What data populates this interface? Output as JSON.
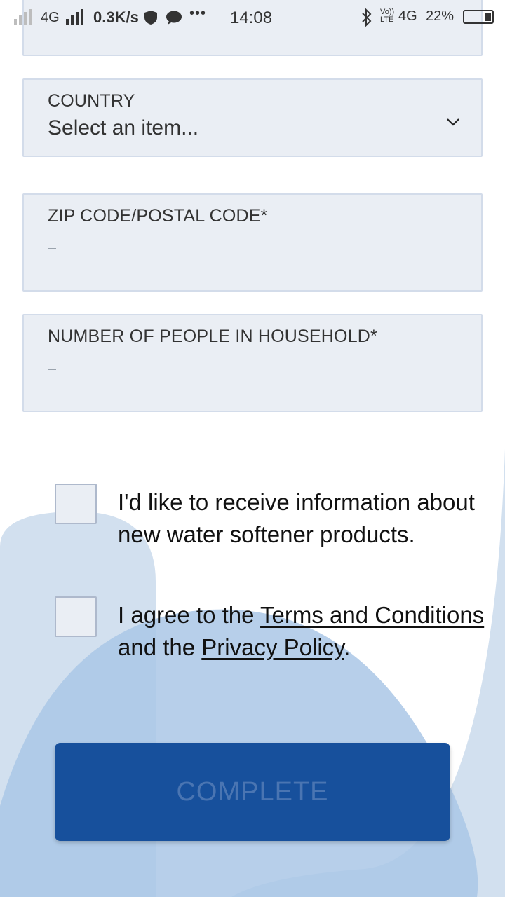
{
  "status_bar": {
    "network_type": "4G",
    "speed": "0.3K/s",
    "more_dots": "•••",
    "time": "14:08",
    "volte": "Vo)) LTE",
    "network_type_2": "4G",
    "battery": "22%"
  },
  "form": {
    "country": {
      "label": "COUNTRY",
      "value": "Select an item..."
    },
    "zip": {
      "label": "ZIP CODE/POSTAL CODE*"
    },
    "household": {
      "label": "NUMBER OF PEOPLE IN HOUSEHOLD*"
    }
  },
  "consent": {
    "marketing_text": "I'd like to receive information about new water softener products.",
    "terms_prefix": "I agree to the ",
    "terms_link": "Terms and Conditions",
    "terms_middle": " and the ",
    "privacy_link": "Privacy Policy",
    "terms_suffix": "."
  },
  "complete_button": {
    "label": "COMPLETE"
  },
  "colors": {
    "button_bg": "#17509c",
    "button_text": "#4a75b2",
    "field_bg": "#eaeef4",
    "field_border": "#d3dcea",
    "decor_light": "#d2e0ef",
    "decor_mid": "#aac7e6"
  }
}
